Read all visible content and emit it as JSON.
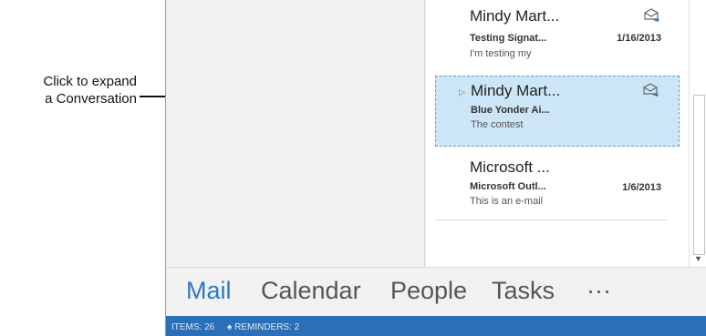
{
  "callout": {
    "line1": "Click to expand",
    "line2": "a Conversation"
  },
  "messages": [
    {
      "sender": "Mindy Mart...",
      "subject": "Testing Signat...",
      "preview": "I'm testing my",
      "date": "1/16/2013",
      "icon": "envelope-reply-icon"
    },
    {
      "sender": "Mindy Mart...",
      "subject": "Blue Yonder Ai...",
      "preview": "The contest",
      "date": "",
      "icon": "envelope-reply-icon",
      "selected": true,
      "expand_glyph": "▷"
    },
    {
      "sender": "Microsoft ...",
      "subject": "Microsoft Outl...",
      "preview": "This is an e-mail",
      "date": "1/6/2013"
    }
  ],
  "nav": {
    "mail": "Mail",
    "calendar": "Calendar",
    "people": "People",
    "tasks": "Tasks",
    "more": "···"
  },
  "status": {
    "items": "ITEMS: 26",
    "reminders": "REMINDERS: 2"
  },
  "colors": {
    "accent": "#2f78c4",
    "statusbar": "#2b6fb8",
    "selected": "#cde6f7"
  }
}
